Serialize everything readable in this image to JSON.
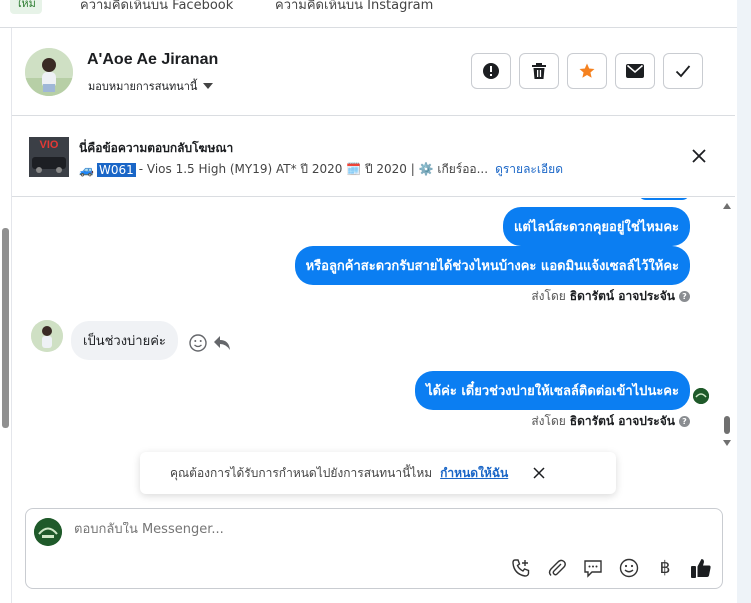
{
  "top_tabs": {
    "new_badge": "ใหม่",
    "facebook_tab": "ความคิดเห็นบน Facebook",
    "instagram_tab": "ความคิดเห็นบน Instagram"
  },
  "header": {
    "name": "A'Aoe Ae Jiranan",
    "assign_label": "มอบหมายการสนทนานี้",
    "actions": [
      "alert-icon",
      "trash-icon",
      "star-icon",
      "envelope-icon",
      "check-icon"
    ],
    "star_color": "#f5811f"
  },
  "ad": {
    "title": "นี่คือข้อความตอบกลับโฆษณา",
    "thumb_text": "VIO",
    "car_emoji": "🚙",
    "code": "W061",
    "desc": "- Vios 1.5 High (MY19) AT* ปี 2020 🗓️ ปี 2020 | ⚙️ เกียร์ออ...",
    "details_link": "ดูรายละเอียด"
  },
  "messages": {
    "out1": "แต่ไลน์สะดวกคุยอยู่ใช่ไหมคะ",
    "out2": "หรือลูกค้าสะดวกรับสายได้ช่วงไหนบ้างคะ แอดมินแจ้งเซลล์ไว้ให้คะ",
    "sentby_prefix": "ส่งโดย",
    "sentby_name": "ธิดารัตน์ อาจประจัน",
    "in1": "เป็นช่วงบ่ายค่ะ",
    "out3": "ได้ค่ะ เดี๋ยวช่วงบ่ายให้เซลล์ติดต่อเข้าไปนะคะ",
    "help_mark": "?"
  },
  "toast": {
    "message": "คุณต้องการได้รับการกำหนดไปยังการสนทนานี้ไหม",
    "link": "กำหนดให้ฉัน"
  },
  "composer": {
    "placeholder": "ตอบกลับใน Messenger...",
    "tools": [
      "call-add-icon",
      "attach-icon",
      "chat-icon",
      "emoji-icon",
      "baht-icon",
      "like-icon"
    ],
    "baht_symbol": "฿"
  },
  "colors": {
    "accent": "#0b7ef2",
    "link": "#1a66c7"
  }
}
